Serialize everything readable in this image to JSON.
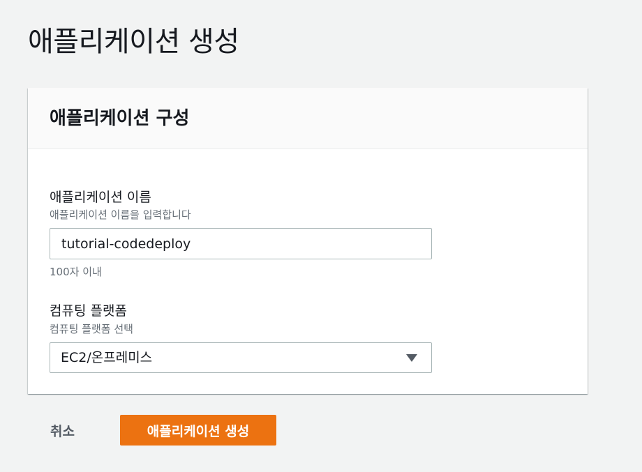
{
  "page": {
    "title": "애플리케이션 생성"
  },
  "panel": {
    "title": "애플리케이션 구성"
  },
  "app_name_field": {
    "label": "애플리케이션 이름",
    "description": "애플리케이션 이름을 입력합니다",
    "value": "tutorial-codedeploy",
    "constraint": "100자 이내"
  },
  "platform_field": {
    "label": "컴퓨팅 플랫폼",
    "description": "컴퓨팅 플랫폼 선택",
    "selected": "EC2/온프레미스"
  },
  "actions": {
    "cancel_label": "취소",
    "create_label": "애플리케이션 생성"
  },
  "colors": {
    "page_background": "#f2f3f3",
    "primary_button": "#ec7211",
    "text": "#16191f",
    "secondary_text": "#687078"
  },
  "icons": {
    "platform_select": "caret-down-icon"
  }
}
